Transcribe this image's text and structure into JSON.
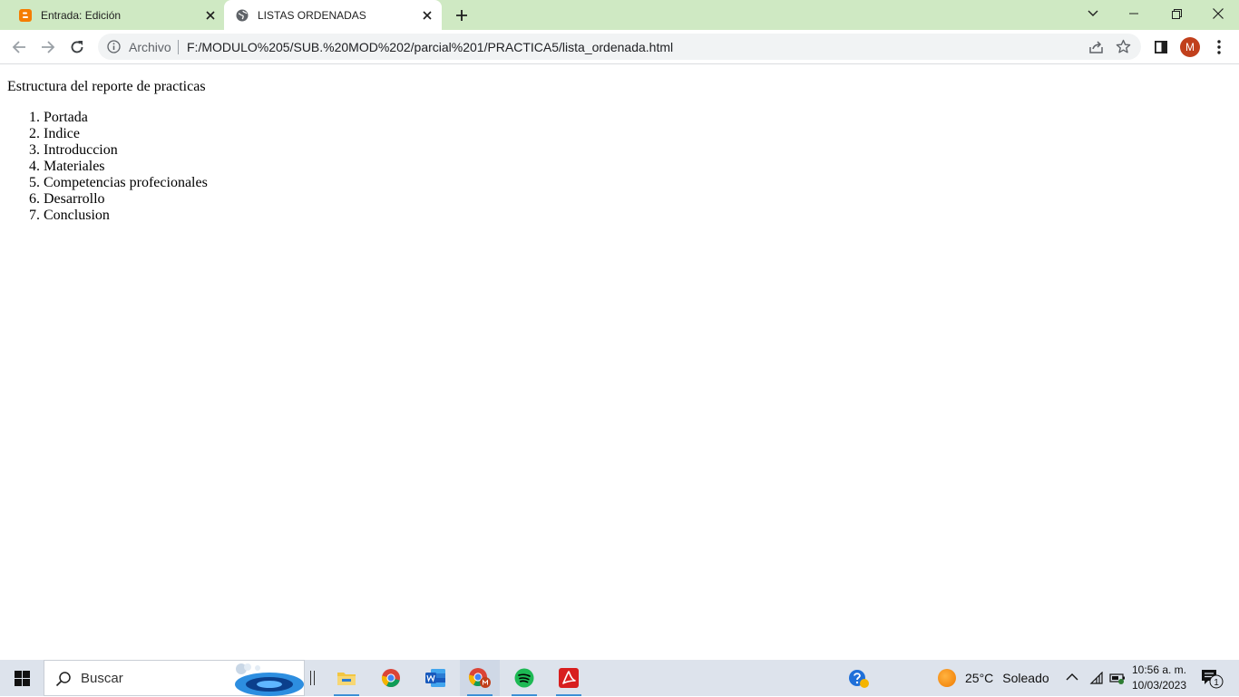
{
  "browser": {
    "tabs": [
      {
        "label": "Entrada: Edición",
        "favicon": "blogger-icon",
        "active": false
      },
      {
        "label": "LISTAS ORDENADAS",
        "favicon": "globe-icon",
        "active": true
      }
    ],
    "address_scheme": "Archivo",
    "address_url": "F:/MODULO%205/SUB.%20MOD%202/parcial%201/PRACTICA5/lista_ordenada.html",
    "profile_initial": "M",
    "accent": "#cfe9c3"
  },
  "page": {
    "heading": "Estructura del reporte de practicas",
    "list": [
      "Portada",
      "Indice",
      "Introduccion",
      "Materiales",
      "Competencias profecionales",
      "Desarrollo",
      "Conclusion"
    ]
  },
  "taskbar": {
    "search_placeholder": "Buscar",
    "apps": [
      "file-explorer-icon",
      "chrome-icon",
      "word-icon",
      "chrome-profile-icon",
      "spotify-icon",
      "acrobat-icon"
    ],
    "weather_temp": "25°C",
    "weather_desc": "Soleado",
    "time": "10:56 a. m.",
    "date": "10/03/2023",
    "notification_count": "1"
  }
}
